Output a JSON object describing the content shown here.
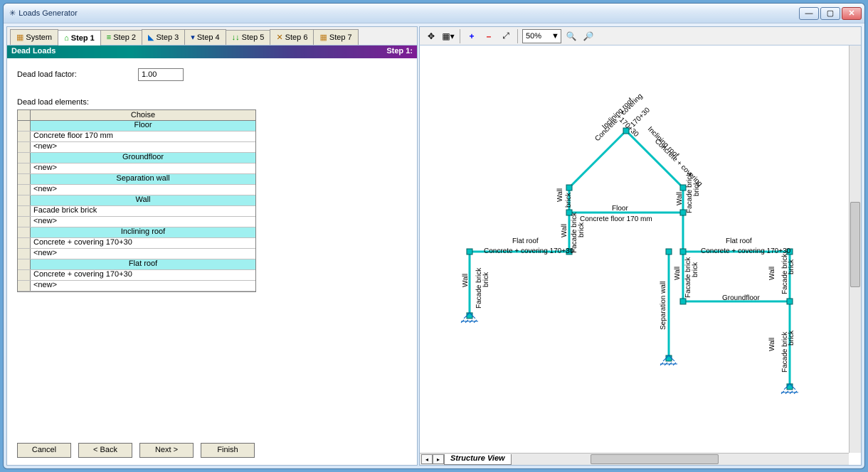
{
  "window": {
    "title": "Loads Generator"
  },
  "tabs": [
    "System",
    "Step 1",
    "Step 2",
    "Step 3",
    "Step 4",
    "Step 5",
    "Step 6",
    "Step 7"
  ],
  "activeTabIndex": 1,
  "section": {
    "title": "Dead Loads",
    "step": "Step 1:"
  },
  "form": {
    "dead_load_factor_label": "Dead load factor:",
    "dead_load_factor_value": "1.00",
    "elements_label": "Dead load elements:",
    "column_header": "Choise"
  },
  "grid_rows": [
    {
      "type": "cat",
      "text": "Floor"
    },
    {
      "type": "item",
      "text": "Concrete floor   170 mm"
    },
    {
      "type": "item",
      "text": "<new>"
    },
    {
      "type": "cat",
      "text": "Groundfloor"
    },
    {
      "type": "item",
      "text": "<new>"
    },
    {
      "type": "cat",
      "text": "Separation wall"
    },
    {
      "type": "item",
      "text": "<new>"
    },
    {
      "type": "cat",
      "text": "Wall"
    },
    {
      "type": "item",
      "text": "Facade brick   brick"
    },
    {
      "type": "item",
      "text": "<new>"
    },
    {
      "type": "cat",
      "text": "Inclining roof"
    },
    {
      "type": "item",
      "text": "Concrete + covering   170+30"
    },
    {
      "type": "item",
      "text": "<new>"
    },
    {
      "type": "cat",
      "text": "Flat roof"
    },
    {
      "type": "item",
      "text": "Concrete + covering   170+30"
    },
    {
      "type": "item",
      "text": "<new>"
    }
  ],
  "buttons": [
    "Cancel",
    "< Back",
    "Next >",
    "Finish"
  ],
  "zoom": "50%",
  "view_tab": "Structure  View",
  "diagram_labels": {
    "inclining_roof": "Inclining roof",
    "conc_cov": "Concrete + covering",
    "roof_dim": "170+30",
    "floor": "Floor",
    "floor_item": "Concrete floor   170 mm",
    "wall": "Wall",
    "facade": "Facade brick",
    "brick": "brick",
    "flat_roof": "Flat roof",
    "flat_item": "Concrete + covering   170+30",
    "separation": "Separation wall",
    "groundfloor": "Groundfloor"
  }
}
